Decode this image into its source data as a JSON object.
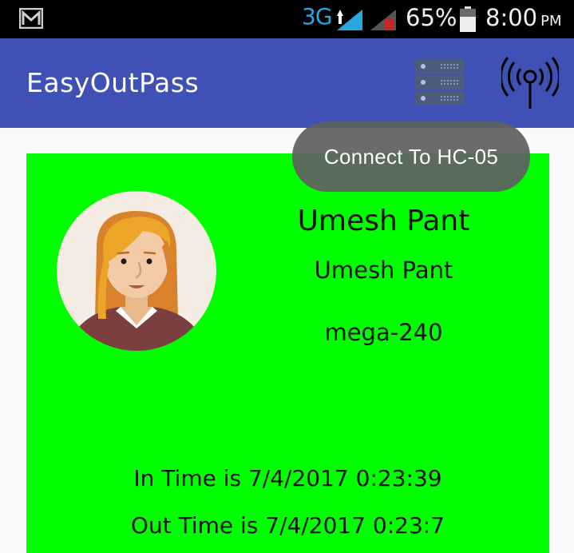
{
  "status_bar": {
    "network_type": "3G",
    "network_sub": "H",
    "battery_percent": "65%",
    "time": "8:00",
    "time_suffix": "PM",
    "icons": [
      "gmail-icon",
      "signal-icon",
      "signal-no-sim-icon",
      "battery-icon"
    ]
  },
  "app_bar": {
    "title": "EasyOutPass",
    "actions": [
      "server-icon",
      "antenna-icon"
    ],
    "color": "#3f51b5"
  },
  "card": {
    "background": "#00ff00",
    "name_primary": "Umesh Pant",
    "name_secondary": "Umesh Pant",
    "device": "mega-240",
    "in_time": "In Time is 7/4/2017 0:23:39",
    "out_time": "Out Time is 7/4/2017 0:23:7",
    "avatar": "female-avatar-icon"
  },
  "toast": {
    "message": "Connect To HC-05"
  }
}
